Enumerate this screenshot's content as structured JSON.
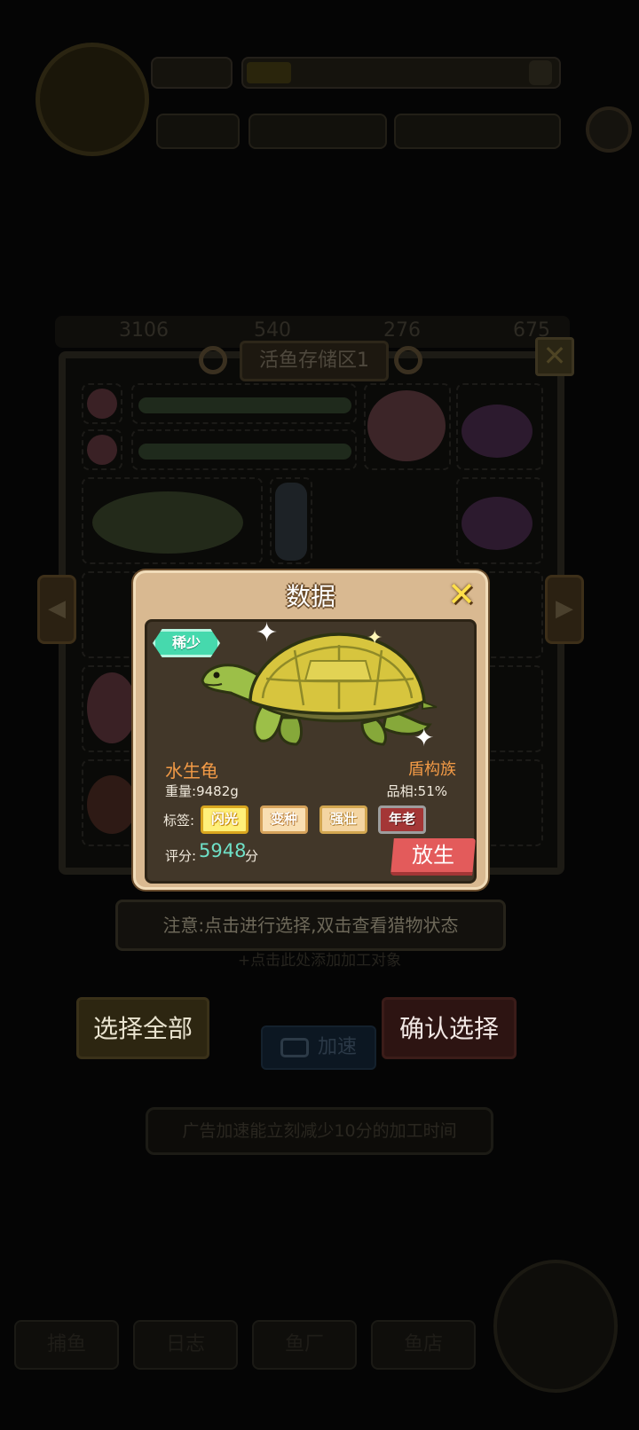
{
  "storage": {
    "title": "活鱼存储区1",
    "resources": [
      "3106",
      "540",
      "276",
      "675"
    ],
    "prev_arrow": "◀",
    "next_arrow": "▶",
    "close_glyph": "✕"
  },
  "notice": "注意:点击进行选择,双击查看猎物状态",
  "add_hint": "+点击此处添加加工对象",
  "buttons": {
    "select_all": "选择全部",
    "confirm": "确认选择",
    "speed_up": "加速"
  },
  "ad_hint": "广告加速能立刻减少10分的加工时间",
  "bottom_tabs": [
    "捕鱼",
    "日志",
    "鱼厂",
    "鱼店"
  ],
  "modal": {
    "title": "数据",
    "close_glyph": "✕",
    "rarity": "稀少",
    "species": "水生龟",
    "family": "盾构族",
    "weight_label": "重量:",
    "weight_value": "9482g",
    "quality_label": "品相:",
    "quality_value": "51%",
    "tags_label": "标签:",
    "tags": [
      "闪光",
      "变种",
      "强壮",
      "年老"
    ],
    "score_label": "评分:",
    "score_value": "5948",
    "score_unit": "分",
    "release": "放生"
  },
  "colors": {
    "accent_orange": "#f29a46",
    "score_teal": "#6fe1c8",
    "rarity_green": "#46d9ad",
    "release_red": "#e35b5b",
    "close_yellow": "#ffe04a"
  },
  "icons": [
    "sparkle-icon",
    "close-icon",
    "camera-icon",
    "gear-icon",
    "arrow-left-icon",
    "arrow-right-icon"
  ]
}
